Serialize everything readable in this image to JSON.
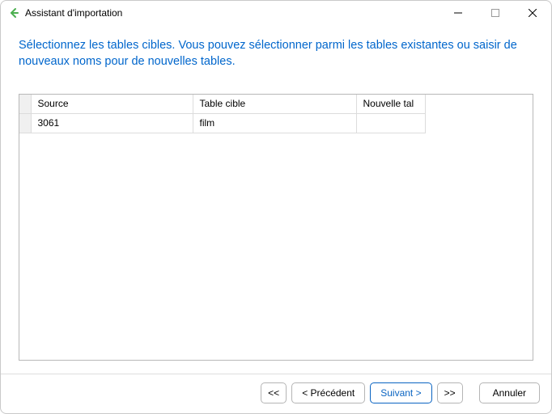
{
  "window": {
    "title": "Assistant d'importation"
  },
  "instruction": "Sélectionnez les tables cibles. Vous pouvez sélectionner parmi les tables existantes ou saisir de nouveaux noms pour de nouvelles tables.",
  "table": {
    "headers": {
      "source": "Source",
      "target": "Table cible",
      "new": "Nouvelle tal"
    },
    "rows": [
      {
        "source": "3061",
        "target": "film",
        "new": ""
      }
    ]
  },
  "footer": {
    "first": "<<",
    "prev": "< Précédent",
    "next": "Suivant >",
    "last": ">>",
    "cancel": "Annuler"
  }
}
